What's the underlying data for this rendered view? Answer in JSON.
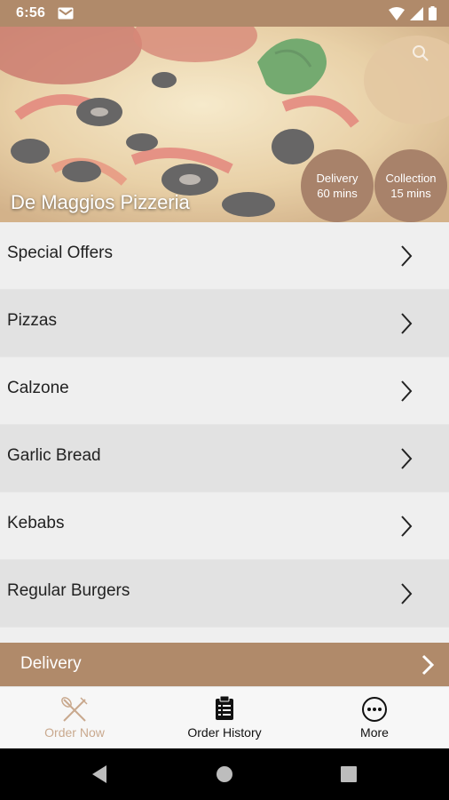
{
  "status_bar": {
    "time": "6:56"
  },
  "hero": {
    "restaurant_name": "De Maggios Pizzeria"
  },
  "badges": {
    "delivery": {
      "label": "Delivery",
      "time": "60 mins"
    },
    "collection": {
      "label": "Collection",
      "time": "15 mins"
    }
  },
  "menu": {
    "items": [
      {
        "label": "Special Offers"
      },
      {
        "label": "Pizzas"
      },
      {
        "label": "Calzone"
      },
      {
        "label": "Garlic Bread"
      },
      {
        "label": "Kebabs"
      },
      {
        "label": "Regular Burgers"
      }
    ]
  },
  "delivery_bar": {
    "label": "Delivery"
  },
  "tabs": {
    "order_now": "Order Now",
    "order_history": "Order History",
    "more": "More"
  },
  "colors": {
    "accent": "#b08a6a",
    "badge": "#a8826a",
    "active_tab": "#c9a98e"
  }
}
